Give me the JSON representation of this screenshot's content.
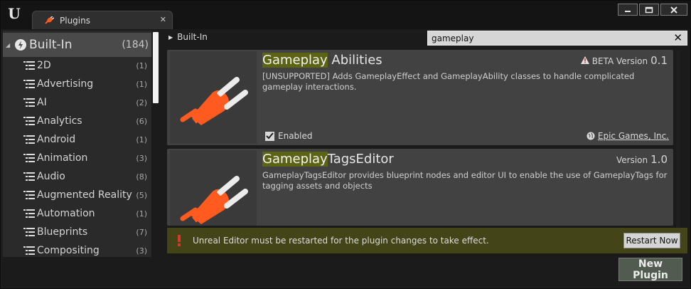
{
  "window": {
    "tab_title": "Plugins",
    "tab_close": "✕",
    "logo": "U",
    "buttons": [
      "minimize-icon",
      "maximize-icon",
      "close-icon"
    ]
  },
  "sidebar": {
    "root": {
      "label": "Built-In",
      "count": "(184)"
    },
    "items": [
      {
        "label": "2D",
        "count": "(1)"
      },
      {
        "label": "Advertising",
        "count": "(1)"
      },
      {
        "label": "AI",
        "count": "(2)"
      },
      {
        "label": "Analytics",
        "count": "(6)"
      },
      {
        "label": "Android",
        "count": "(1)"
      },
      {
        "label": "Animation",
        "count": "(3)"
      },
      {
        "label": "Audio",
        "count": "(8)"
      },
      {
        "label": "Augmented Reality",
        "count": "(5)"
      },
      {
        "label": "Automation",
        "count": "(1)"
      },
      {
        "label": "Blueprints",
        "count": "(7)"
      },
      {
        "label": "Compositing",
        "count": "(3)"
      }
    ]
  },
  "breadcrumb": {
    "label": "Built-In"
  },
  "search": {
    "value": "gameplay",
    "clear": "✕"
  },
  "plugins": [
    {
      "title_highlight": "Gameplay",
      "title_rest": " Abilities",
      "version_prefix": "BETA Version",
      "version": "0.1",
      "description": "[UNSUPPORTED] Adds GameplayEffect and GameplayAbility classes to handle complicated gameplay interactions.",
      "enabled_label": "Enabled",
      "vendor": "Epic Games, Inc."
    },
    {
      "title_highlight": "Gameplay",
      "title_rest": "TagsEditor",
      "version_prefix": "Version",
      "version": "1.0",
      "description": "GameplayTagsEditor provides blueprint nodes and editor UI to enable the use of GameplayTags for tagging assets and objects"
    }
  ],
  "restart": {
    "message": "Unreal Editor must be restarted for the plugin changes to take effect.",
    "button": "Restart Now"
  },
  "new_plugin_button": "New Plugin",
  "colors": {
    "highlight": "#5c6414",
    "plug": "#ff5a1f",
    "restart_bar": "#434418"
  }
}
